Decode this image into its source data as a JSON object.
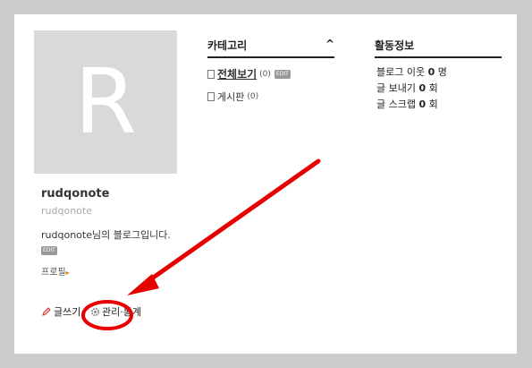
{
  "profile": {
    "avatar_letter": "R",
    "name": "rudqonote",
    "id": "rudqonote",
    "description": "rudqonote님의 블로그입니다.",
    "edit_label": "EDIT",
    "profile_link": "프로필"
  },
  "actions": {
    "write": "글쓰기",
    "manage": "관리·통계"
  },
  "category": {
    "title": "카테고리",
    "toggle": "^",
    "items": [
      {
        "label": "전체보기",
        "count": "(0)",
        "edit": "EDIT"
      },
      {
        "label": "게시판",
        "count": "(0)"
      }
    ]
  },
  "activity": {
    "title": "활동정보",
    "rows": [
      {
        "label": "블로그 이웃",
        "value": "0",
        "unit": "명"
      },
      {
        "label": "글 보내기",
        "value": "0",
        "unit": "회"
      },
      {
        "label": "글 스크랩",
        "value": "0",
        "unit": "회"
      }
    ]
  },
  "colors": {
    "annotation": "#e60000"
  }
}
